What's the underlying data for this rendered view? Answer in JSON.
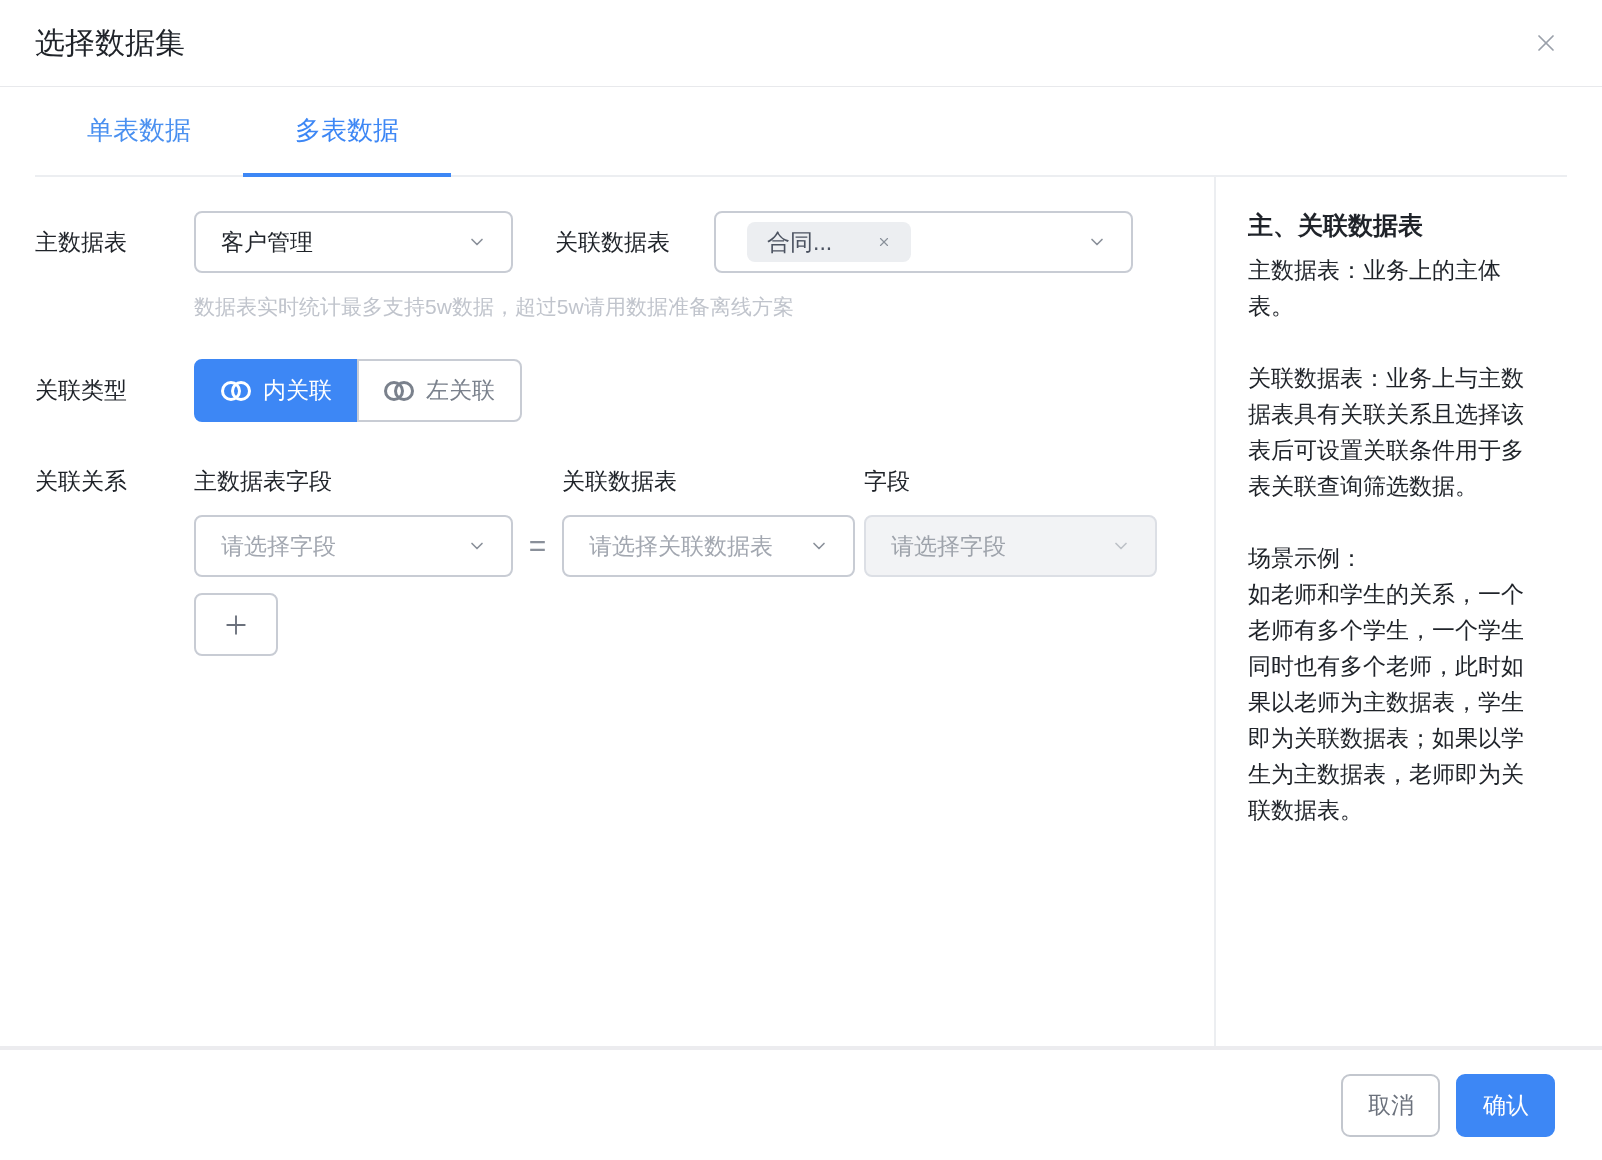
{
  "dialog": {
    "title": "选择数据集"
  },
  "tabs": [
    {
      "label": "单表数据",
      "selected": false
    },
    {
      "label": "多表数据",
      "selected": true
    }
  ],
  "form": {
    "main_table": {
      "label": "主数据表",
      "value": "客户管理"
    },
    "related_table": {
      "label": "关联数据表",
      "tags": [
        "合同..."
      ]
    },
    "hint": "数据表实时统计最多支持5w数据，超过5w请用数据准备离线方案",
    "join_type": {
      "label": "关联类型",
      "options": [
        {
          "label": "内关联",
          "selected": true
        },
        {
          "label": "左关联",
          "selected": false
        }
      ]
    },
    "relation": {
      "label": "关联关系",
      "columns": [
        "主数据表字段",
        "关联数据表",
        "字段"
      ],
      "operator": "=",
      "selects": [
        {
          "placeholder": "请选择字段",
          "disabled": false
        },
        {
          "placeholder": "请选择关联数据表",
          "disabled": false
        },
        {
          "placeholder": "请选择字段",
          "disabled": true
        }
      ]
    }
  },
  "help": {
    "title": "主、关联数据表",
    "paragraphs": [
      "主数据表：业务上的主体表。",
      "关联数据表：业务上与主数据表具有关联关系且选择该表后可设置关联条件用于多表关联查询筛选数据。"
    ],
    "example_label": "场景示例：",
    "example": "如老师和学生的关系，一个老师有多个学生，一个学生同时也有多个老师，此时如果以老师为主数据表，学生即为关联数据表；如果以学生为主数据表，老师即为关联数据表。"
  },
  "buttons": [
    {
      "label": "取消",
      "kind": "secondary"
    },
    {
      "label": "确认",
      "kind": "primary"
    }
  ]
}
